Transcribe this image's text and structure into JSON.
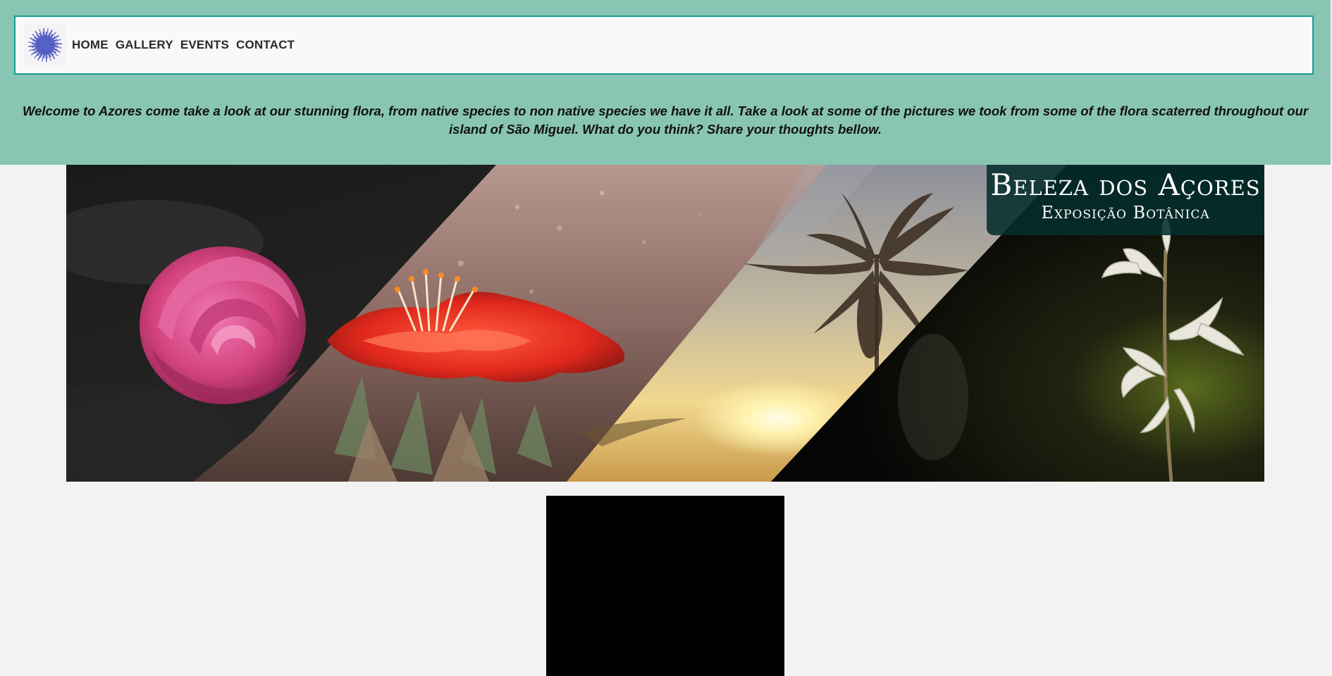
{
  "nav": {
    "logo_icon": "blue-thistle-flower-logo",
    "links": [
      "HOME",
      "GALLERY",
      "EVENTS",
      "CONTACT"
    ]
  },
  "intro": {
    "text": "Welcome to Azores come take a look at our stunning flora, from native species to non native species we have it all. Take a look at some of the pictures we took from some of the flora scaterred throughout our island of São Miguel. What do you think? Share your thoughts bellow."
  },
  "banner": {
    "title": "Beleza dos Açores",
    "subtitle": "Exposição Botânica",
    "panels": [
      "pink-rose",
      "red-flower",
      "sunset-silhouette-plant",
      "white-flower-on-dark"
    ]
  },
  "colors": {
    "header_band": "#89c5b3",
    "nav_border": "#1a9c94",
    "page_background": "#f2f2f2",
    "banner_title_box": "#042e2c",
    "video": "#000000"
  }
}
